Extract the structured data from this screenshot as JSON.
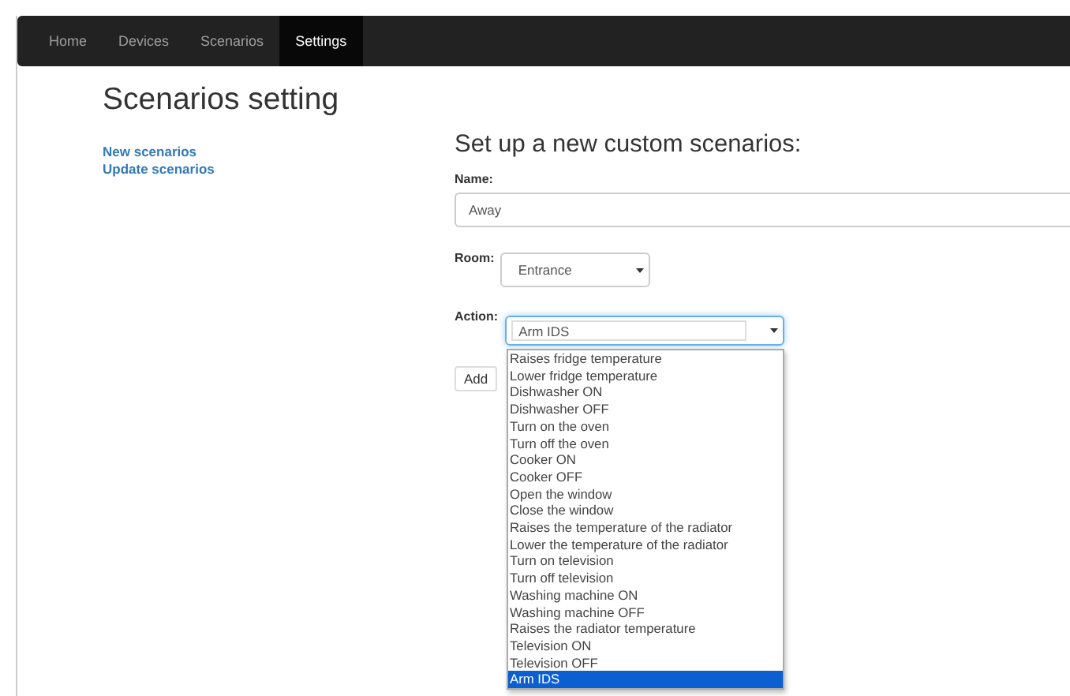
{
  "nav": [
    {
      "label": "Home",
      "selected": false
    },
    {
      "label": "Devices",
      "selected": false
    },
    {
      "label": "Scenarios",
      "selected": false
    },
    {
      "label": "Settings",
      "selected": true
    }
  ],
  "page_title": "Scenarios setting",
  "sidebar": {
    "items": [
      {
        "label": "New scenarios"
      },
      {
        "label": "Update scenarios"
      }
    ]
  },
  "form": {
    "title": "Set up a new custom scenarios:",
    "name_label": "Name:",
    "name_value": "Away",
    "room_label": "Room:",
    "room_value": "Entrance",
    "action_label": "Action:",
    "action_value": "Arm IDS",
    "add_button": "Add",
    "action_options": [
      {
        "label": "Raises fridge temperature",
        "selected": false
      },
      {
        "label": "Lower fridge temperature",
        "selected": false
      },
      {
        "label": "Dishwasher ON",
        "selected": false
      },
      {
        "label": "Dishwasher OFF",
        "selected": false
      },
      {
        "label": "Turn on the oven",
        "selected": false
      },
      {
        "label": "Turn off the oven",
        "selected": false
      },
      {
        "label": "Cooker ON",
        "selected": false
      },
      {
        "label": "Cooker OFF",
        "selected": false
      },
      {
        "label": "Open the window",
        "selected": false
      },
      {
        "label": "Close the window",
        "selected": false
      },
      {
        "label": "Raises the temperature of the radiator",
        "selected": false
      },
      {
        "label": "Lower the temperature of the radiator",
        "selected": false
      },
      {
        "label": "Turn on television",
        "selected": false
      },
      {
        "label": "Turn off television",
        "selected": false
      },
      {
        "label": "Washing machine ON",
        "selected": false
      },
      {
        "label": "Washing machine OFF",
        "selected": false
      },
      {
        "label": "Raises the radiator temperature",
        "selected": false
      },
      {
        "label": "Television ON",
        "selected": false
      },
      {
        "label": "Television OFF",
        "selected": false
      },
      {
        "label": "Arm IDS",
        "selected": true
      }
    ]
  }
}
